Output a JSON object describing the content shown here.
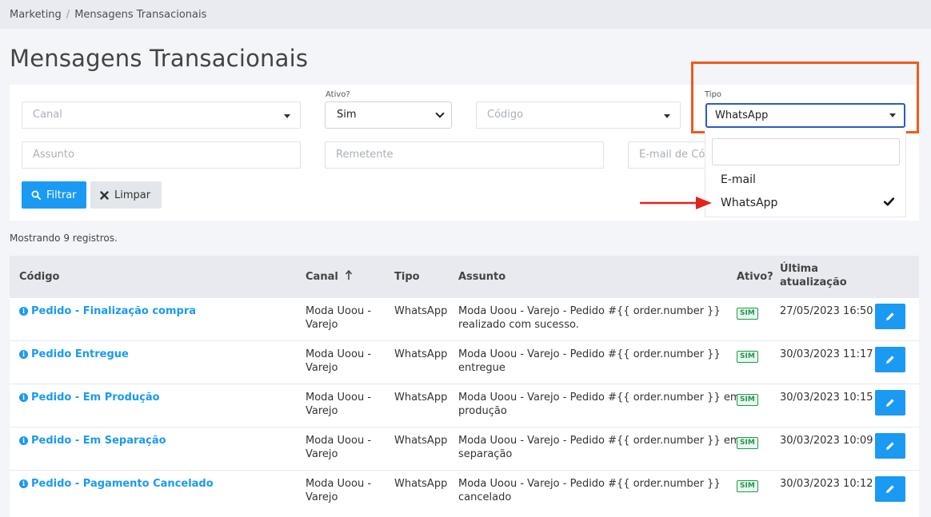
{
  "breadcrumb": {
    "items": [
      "Marketing",
      "Mensagens Transacionais"
    ],
    "separator": "/"
  },
  "page": {
    "title": "Mensagens Transacionais"
  },
  "filters": {
    "canal": {
      "placeholder": "Canal"
    },
    "ativo": {
      "label": "Ativo?",
      "value": "Sim"
    },
    "codigo": {
      "placeholder": "Código"
    },
    "tipo": {
      "label": "Tipo",
      "value": "WhatsApp"
    },
    "assunto": {
      "placeholder": "Assunto"
    },
    "remetente": {
      "placeholder": "Remetente"
    },
    "email_copia": {
      "placeholder": "E-mail de Cóp"
    },
    "filter_button": "Filtrar",
    "clear_button": "Limpar"
  },
  "tipo_dropdown": {
    "options": [
      "E-mail",
      "WhatsApp"
    ],
    "selected": "WhatsApp"
  },
  "results": {
    "count_text": "Mostrando 9 registros."
  },
  "table": {
    "headers": {
      "codigo": "Código",
      "canal": "Canal",
      "tipo": "Tipo",
      "assunto": "Assunto",
      "ativo": "Ativo?",
      "ultima_1": "Última",
      "ultima_2": "atualização"
    },
    "rows": [
      {
        "codigo": "Pedido - Finalização compra",
        "canal_1": "Moda Uoou -",
        "canal_2": "Varejo",
        "tipo": "WhatsApp",
        "assunto_1": "Moda Uoou - Varejo - Pedido #{{ order.number }}",
        "assunto_2": "realizado com sucesso.",
        "ativo": "SIM",
        "atualizacao": "27/05/2023 16:50"
      },
      {
        "codigo": "Pedido Entregue",
        "canal_1": "Moda Uoou -",
        "canal_2": "Varejo",
        "tipo": "WhatsApp",
        "assunto_1": "Moda Uoou - Varejo - Pedido #{{ order.number }}",
        "assunto_2": "entregue",
        "ativo": "SIM",
        "atualizacao": "30/03/2023 11:17"
      },
      {
        "codigo": "Pedido - Em Produção",
        "canal_1": "Moda Uoou -",
        "canal_2": "Varejo",
        "tipo": "WhatsApp",
        "assunto_1": "Moda Uoou - Varejo - Pedido #{{ order.number }} em",
        "assunto_2": "produção",
        "ativo": "SIM",
        "atualizacao": "30/03/2023 10:15"
      },
      {
        "codigo": "Pedido - Em Separação",
        "canal_1": "Moda Uoou -",
        "canal_2": "Varejo",
        "tipo": "WhatsApp",
        "assunto_1": "Moda Uoou - Varejo - Pedido #{{ order.number }} em",
        "assunto_2": "separação",
        "ativo": "SIM",
        "atualizacao": "30/03/2023 10:09"
      },
      {
        "codigo": "Pedido - Pagamento Cancelado",
        "canal_1": "Moda Uoou -",
        "canal_2": "Varejo",
        "tipo": "WhatsApp",
        "assunto_1": "Moda Uoou - Varejo - Pedido #{{ order.number }}",
        "assunto_2": "cancelado",
        "ativo": "SIM",
        "atualizacao": "30/03/2023 10:12"
      }
    ]
  },
  "colors": {
    "primary": "#1a9af2",
    "highlight": "#ef5a1c",
    "arrow": "#e3231c",
    "badge_green": "#1f9a4b"
  },
  "icons": {
    "filter": "search-icon",
    "clear": "close-icon",
    "info": "info-icon",
    "edit": "pencil-icon",
    "sort": "sort-up-arrow-icon",
    "check": "checkmark-icon"
  }
}
